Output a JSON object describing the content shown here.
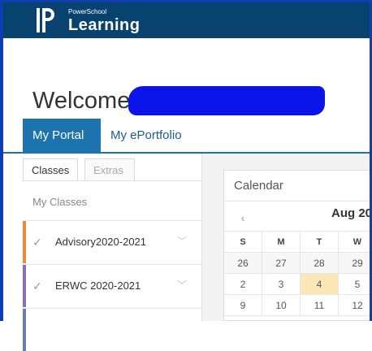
{
  "header": {
    "brand_small": "PowerSchool",
    "brand_large": "Learning",
    "logo_icon": "powerschool-logo-icon",
    "background": "#08426e"
  },
  "welcome": {
    "text": "Welcome,"
  },
  "tabs": [
    {
      "label": "My Portal",
      "active": true
    },
    {
      "label": "My ePortfolio",
      "active": false
    }
  ],
  "left_panel": {
    "subtabs": [
      {
        "label": "Classes",
        "active": true
      },
      {
        "label": "Extras",
        "active": false
      }
    ],
    "section_label": "My Classes",
    "classes": [
      {
        "label": "Advisory2020-2021",
        "color": "#f08a3a",
        "check_icon": "check-icon",
        "chevron_icon": "chevron-down-icon"
      },
      {
        "label": "ERWC 2020-2021",
        "color": "#8a6fb5",
        "check_icon": "check-icon",
        "chevron_icon": "chevron-down-icon"
      }
    ]
  },
  "calendar": {
    "title": "Calendar",
    "month": "Aug 20",
    "prev_icon": "chevron-left-icon",
    "weekdays": [
      "S",
      "M",
      "T",
      "W"
    ],
    "weeks": [
      [
        "26",
        "27",
        "28",
        "29"
      ],
      [
        "2",
        "3",
        "4",
        "5"
      ],
      [
        "9",
        "10",
        "11",
        "12"
      ]
    ],
    "today": "4",
    "today_color": "#fce8b6"
  }
}
